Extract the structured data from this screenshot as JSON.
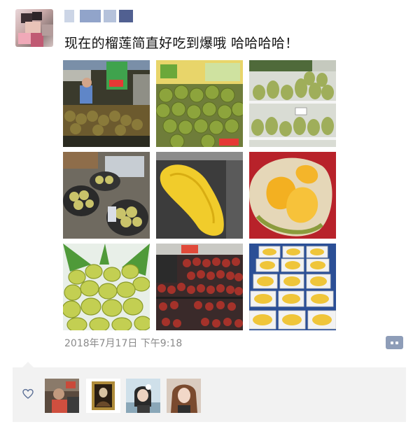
{
  "post": {
    "text": "现在的榴莲简直好吃到爆哦 哈哈哈哈！",
    "timestamp": "2018年7月17日 下午9:18"
  },
  "images": [
    {
      "id": "durian-stall-night"
    },
    {
      "id": "durian-pile-green"
    },
    {
      "id": "durian-shelves"
    },
    {
      "id": "durian-baskets"
    },
    {
      "id": "durian-flesh-yellow"
    },
    {
      "id": "durian-opened"
    },
    {
      "id": "green-coconuts"
    },
    {
      "id": "mangosteen-trays"
    },
    {
      "id": "durian-packed-boxes"
    }
  ],
  "likes": {
    "icon": "heart-outline-icon",
    "count": 4
  },
  "colors": {
    "accent": "#8e9db8",
    "name_blur": "#6c86b8",
    "timestamp": "#8a8a8a",
    "likes_bg": "#f2f2f2"
  }
}
